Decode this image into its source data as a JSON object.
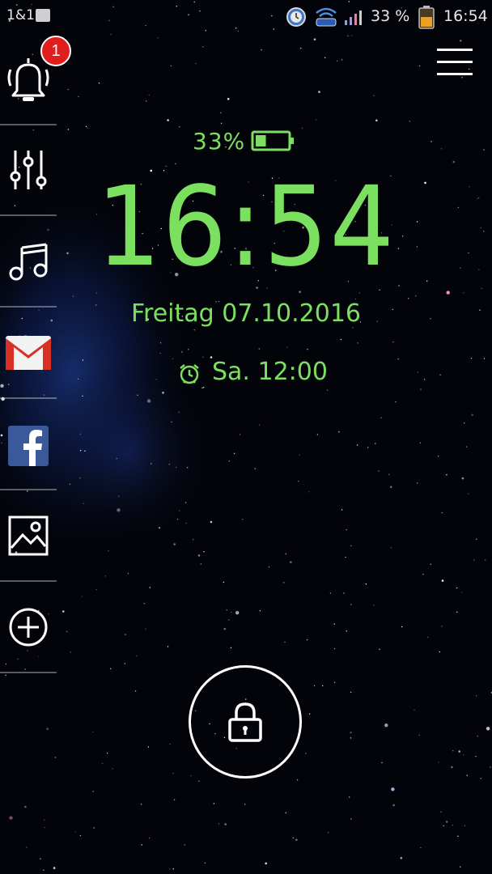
{
  "status_bar": {
    "carrier": "1&1",
    "battery_percent": "33 %",
    "time": "16:54",
    "icons": [
      "image-icon",
      "alarm-clock-icon",
      "wifi-icon",
      "signal-icon",
      "battery-icon"
    ]
  },
  "sidebar": {
    "items": [
      {
        "icon": "bell-icon",
        "badge": "1"
      },
      {
        "icon": "equalizer-icon"
      },
      {
        "icon": "music-note-icon"
      },
      {
        "icon": "gmail-icon"
      },
      {
        "icon": "facebook-icon"
      },
      {
        "icon": "gallery-icon"
      },
      {
        "icon": "add-circle-icon"
      }
    ]
  },
  "lockscreen": {
    "battery_text": "33%",
    "battery_level": 0.33,
    "clock": "16:54",
    "date": "Freitag 07.10.2016",
    "alarm": "Sa. 12:00",
    "accent_color": "#7be05f"
  },
  "lock_button": {
    "icon": "padlock-icon"
  },
  "menu": {
    "icon": "hamburger-menu-icon"
  }
}
